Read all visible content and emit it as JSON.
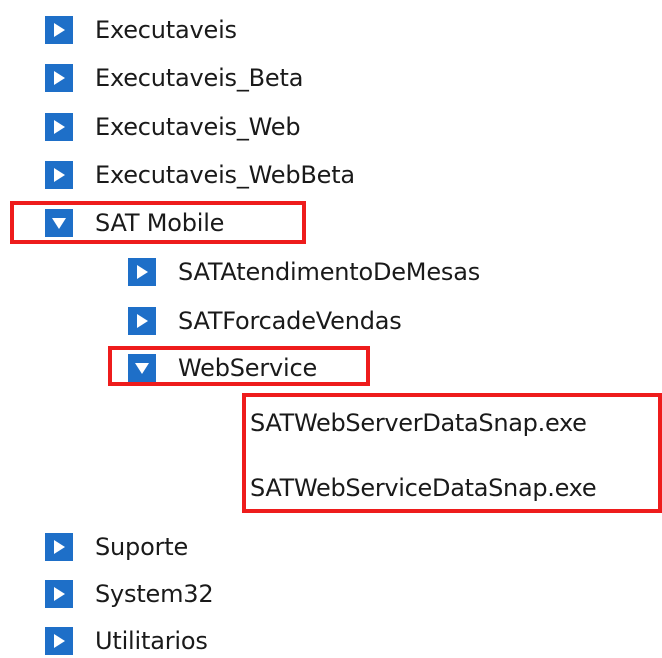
{
  "tree": {
    "nodes": [
      {
        "label": "Executaveis",
        "state": "collapsed"
      },
      {
        "label": "Executaveis_Beta",
        "state": "collapsed"
      },
      {
        "label": "Executaveis_Web",
        "state": "collapsed"
      },
      {
        "label": "Executaveis_WebBeta",
        "state": "collapsed"
      },
      {
        "label": "SAT Mobile",
        "state": "expanded"
      },
      {
        "label": "SATAtendimentoDeMesas",
        "state": "collapsed"
      },
      {
        "label": "SATForcadeVendas",
        "state": "collapsed"
      },
      {
        "label": "WebService",
        "state": "expanded"
      },
      {
        "label": "Suporte",
        "state": "collapsed"
      },
      {
        "label": "System32",
        "state": "collapsed"
      },
      {
        "label": "Utilitarios",
        "state": "collapsed"
      }
    ],
    "files": [
      "SATWebServerDataSnap.exe",
      "SATWebServiceDataSnap.exe"
    ]
  },
  "colors": {
    "toggle_bg": "#1e6fc8",
    "toggle_arrow": "#ffffff",
    "highlight": "#ee1c1c",
    "text": "#1a1a1a"
  },
  "icons": {
    "collapsed": "triangle-right-icon",
    "expanded": "triangle-down-icon"
  }
}
